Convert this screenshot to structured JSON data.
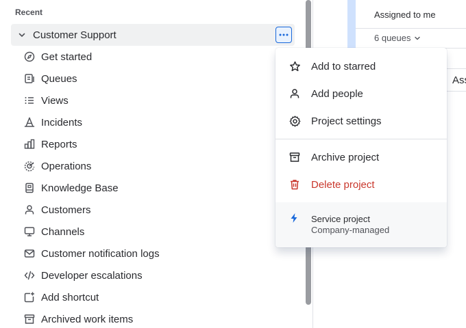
{
  "sidebar": {
    "section_title": "Recent",
    "project": {
      "name": "Customer Support",
      "more_label": "…"
    },
    "items": [
      {
        "label": "Get started",
        "icon": "compass-icon"
      },
      {
        "label": "Queues",
        "icon": "queue-icon"
      },
      {
        "label": "Views",
        "icon": "list-icon"
      },
      {
        "label": "Incidents",
        "icon": "incident-icon"
      },
      {
        "label": "Reports",
        "icon": "chart-icon"
      },
      {
        "label": "Operations",
        "icon": "operations-icon"
      },
      {
        "label": "Knowledge Base",
        "icon": "book-icon"
      },
      {
        "label": "Customers",
        "icon": "person-icon"
      },
      {
        "label": "Channels",
        "icon": "monitor-icon"
      },
      {
        "label": "Customer notification logs",
        "icon": "mail-icon"
      },
      {
        "label": "Developer escalations",
        "icon": "code-icon"
      },
      {
        "label": "Add shortcut",
        "icon": "add-shortcut-icon"
      },
      {
        "label": "Archived work items",
        "icon": "archive-icon"
      }
    ]
  },
  "content": {
    "assigned_label": "Assigned to me",
    "queues_label": "6 queues",
    "column_label": "Ass"
  },
  "menu": {
    "items": [
      {
        "label": "Add to starred",
        "icon": "star-icon"
      },
      {
        "label": "Add people",
        "icon": "person-icon"
      },
      {
        "label": "Project settings",
        "icon": "gear-icon"
      },
      {
        "label": "Archive project",
        "icon": "archive-icon"
      },
      {
        "label": "Delete project",
        "icon": "trash-icon"
      }
    ],
    "footer": {
      "type": "Service project",
      "management": "Company-managed",
      "icon": "lightning-icon"
    }
  },
  "colors": {
    "accent": "#1868db",
    "danger": "#c9372c",
    "selected_bg": "#f0f1f2"
  }
}
